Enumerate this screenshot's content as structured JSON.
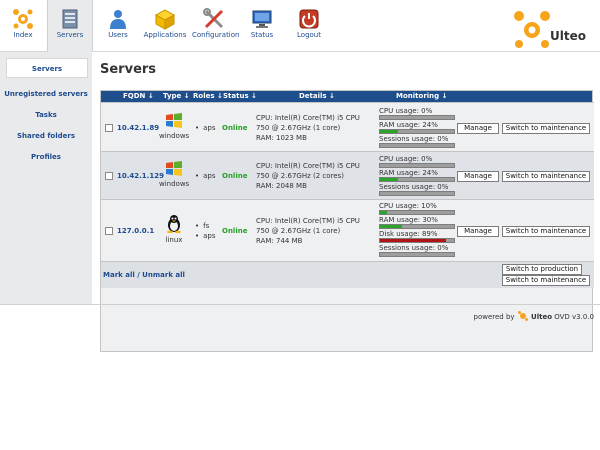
{
  "topnav": {
    "items": [
      {
        "label": "Index",
        "icon": "index-icon"
      },
      {
        "label": "Servers",
        "icon": "servers-icon"
      },
      {
        "label": "Users",
        "icon": "users-icon"
      },
      {
        "label": "Applications",
        "icon": "applications-icon"
      },
      {
        "label": "Configuration",
        "icon": "configuration-icon"
      },
      {
        "label": "Status",
        "icon": "status-icon"
      },
      {
        "label": "Logout",
        "icon": "logout-icon"
      }
    ],
    "active": "Servers",
    "brand": "Ulteo"
  },
  "sidebar": {
    "items": [
      {
        "label": "Servers"
      },
      {
        "label": "Unregistered servers"
      },
      {
        "label": "Tasks"
      },
      {
        "label": "Shared folders"
      },
      {
        "label": "Profiles"
      }
    ]
  },
  "main": {
    "title": "Servers",
    "columns": [
      "FQDN ↓",
      "Type ↓",
      "Roles ↓",
      "Status ↓",
      "Details ↓",
      "Monitoring ↓"
    ],
    "servers": [
      {
        "fqdn": "10.42.1.89",
        "os": "windows",
        "roles": [
          "aps"
        ],
        "status": "Online",
        "cpu": "CPU: Intel(R) Core(TM) i5 CPU 750 @ 2.67GHz (1 core)",
        "ram": "RAM: 1023 MB",
        "monitors": [
          {
            "label": "CPU usage: 0%",
            "value": 0,
            "color": "#2aa52a"
          },
          {
            "label": "RAM usage: 24%",
            "value": 24,
            "color": "#2aa52a"
          },
          {
            "label": "Sessions usage: 0%",
            "value": 0,
            "color": "#2aa52a"
          }
        ],
        "manage": "Manage",
        "switch": "Switch to maintenance"
      },
      {
        "fqdn": "10.42.1.129",
        "os": "windows",
        "roles": [
          "aps"
        ],
        "status": "Online",
        "cpu": "CPU: Intel(R) Core(TM) i5 CPU 750 @ 2.67GHz (2 cores)",
        "ram": "RAM: 2048 MB",
        "monitors": [
          {
            "label": "CPU usage: 0%",
            "value": 0,
            "color": "#2aa52a"
          },
          {
            "label": "RAM usage: 24%",
            "value": 24,
            "color": "#2aa52a"
          },
          {
            "label": "Sessions usage: 0%",
            "value": 0,
            "color": "#2aa52a"
          }
        ],
        "manage": "Manage",
        "switch": "Switch to maintenance"
      },
      {
        "fqdn": "127.0.0.1",
        "os": "linux",
        "roles": [
          "fs",
          "aps"
        ],
        "status": "Online",
        "cpu": "CPU: Intel(R) Core(TM) i5 CPU 750 @ 2.67GHz (1 core)",
        "ram": "RAM: 744 MB",
        "monitors": [
          {
            "label": "CPU usage: 10%",
            "value": 10,
            "color": "#2aa52a"
          },
          {
            "label": "RAM usage: 30%",
            "value": 30,
            "color": "#2aa52a"
          },
          {
            "label": "Disk usage: 89%",
            "value": 89,
            "color": "#b01515"
          },
          {
            "label": "Sessions usage: 0%",
            "value": 0,
            "color": "#2aa52a"
          }
        ],
        "manage": "Manage",
        "switch": "Switch to maintenance"
      }
    ],
    "footer": {
      "markall": "Mark all / Unmark all",
      "to_production": "Switch to production",
      "to_maintenance": "Switch to maintenance"
    }
  },
  "powered": {
    "prefix": "powered by",
    "brand": "Ulteo",
    "suffix": "OVD v3.0.0"
  }
}
